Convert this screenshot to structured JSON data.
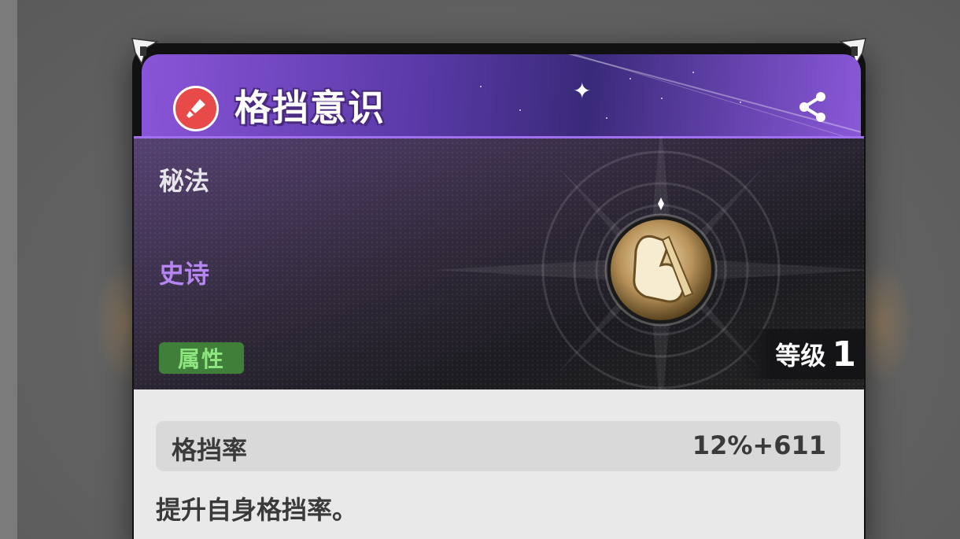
{
  "skill": {
    "title": "格挡意识",
    "category": "秘法",
    "rarity": "史诗",
    "attribute_badge": "属性",
    "level_label": "等级",
    "level_value": "1",
    "stat_name": "格挡率",
    "stat_value": "12%+611",
    "description": "提升自身格挡率。"
  },
  "icons": {
    "title_icon": "sword-icon",
    "share": "share-icon",
    "emblem": "fist-emblem-icon"
  },
  "colors": {
    "header_purple": "#8a55d8",
    "rarity_purple": "#b685f2",
    "badge_green": "#3f7f3a",
    "badge_text_green": "#8ee57e",
    "title_icon_red": "#e84a4a"
  }
}
